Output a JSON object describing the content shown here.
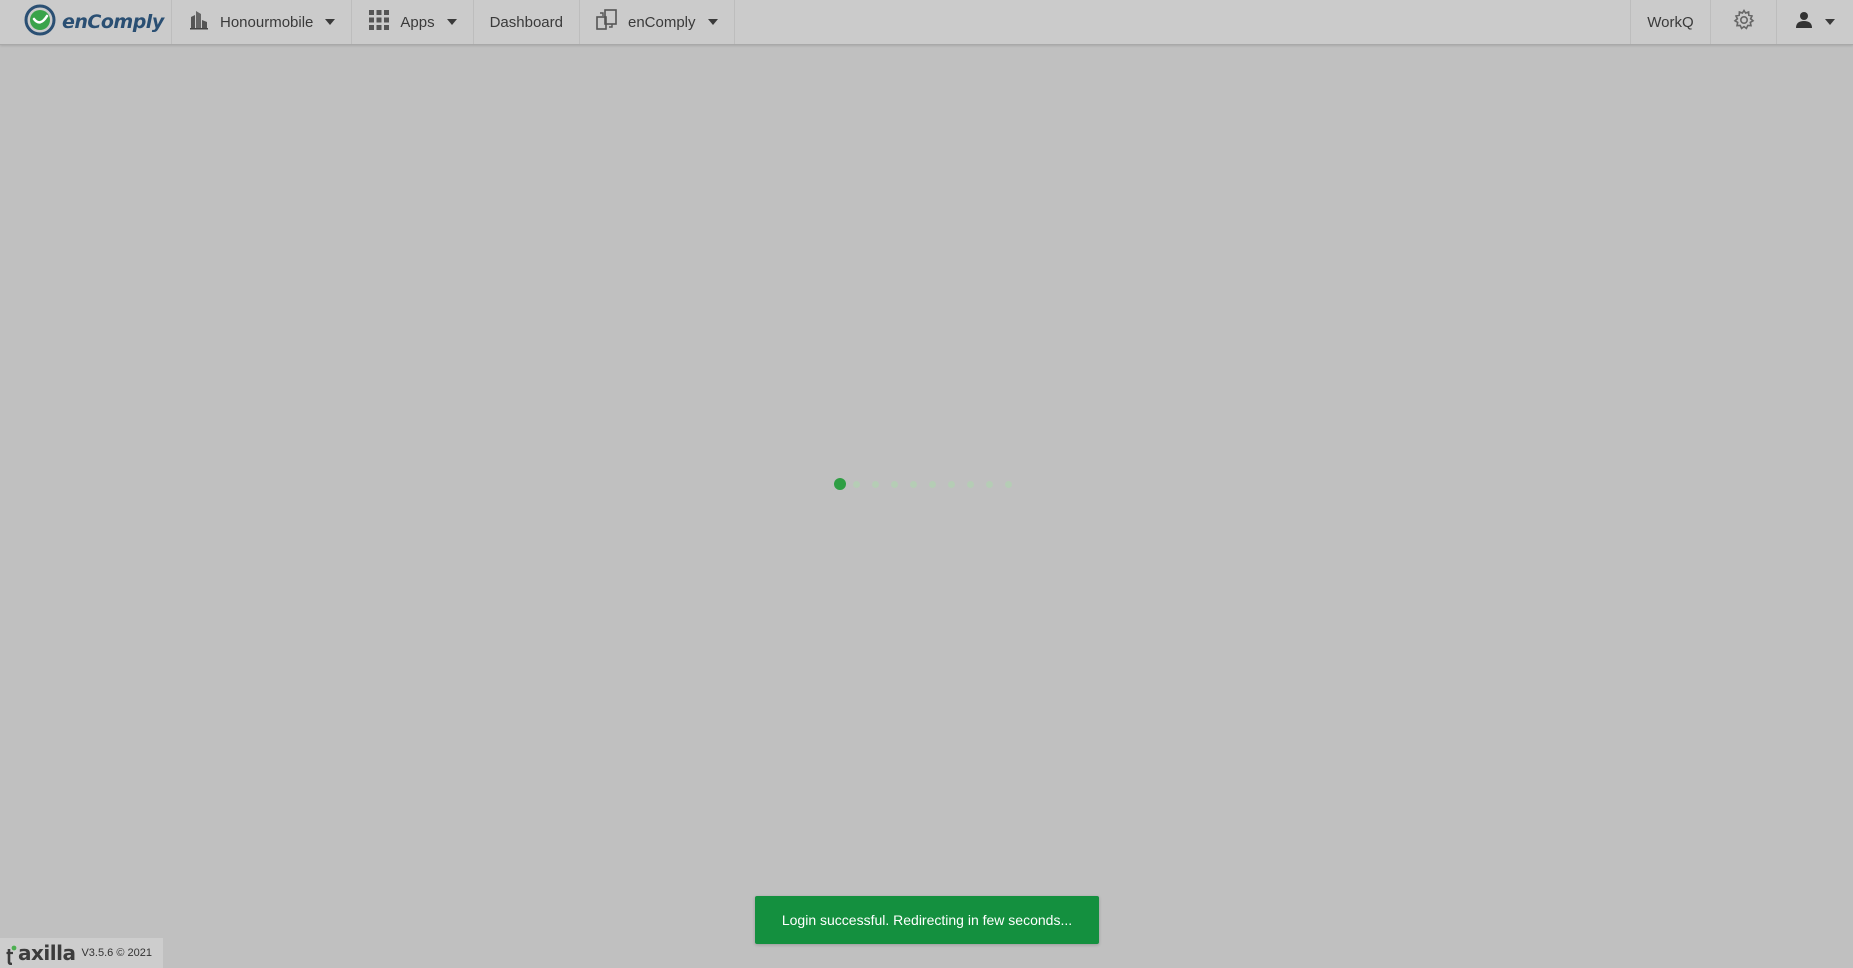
{
  "header": {
    "brand_name": "enComply",
    "org_label": "Honourmobile",
    "apps_label": "Apps",
    "dashboard_label": "Dashboard",
    "app_switcher_label": "enComply",
    "workq_label": "WorkQ"
  },
  "loader": {
    "dot_count": 10,
    "active_index": 0,
    "active_color": "#2f9e44",
    "inactive_color": "#b5cdb5"
  },
  "toast": {
    "message": "Login successful. Redirecting in few seconds...",
    "color": "#14903f"
  },
  "footer": {
    "brand_text": "axilla",
    "version_text": "V3.5.6 © 2021"
  },
  "icons": {
    "logo": "encomply-logo-icon",
    "org": "building-icon",
    "apps": "grid-icon",
    "app_switch": "app-switch-icon",
    "settings": "gear-icon",
    "user": "user-icon"
  }
}
